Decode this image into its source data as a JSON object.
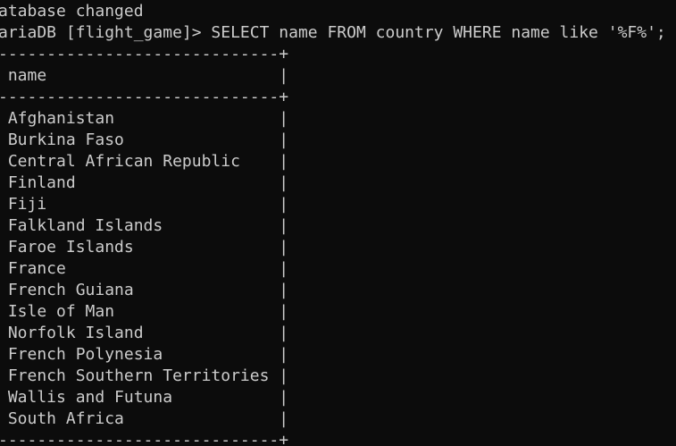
{
  "terminal": {
    "status_line": "atabase changed",
    "prompt": "ariaDB [flight_game]> ",
    "command": "SELECT name FROM country WHERE name like '%F%';",
    "border_top": "-----------------------------+",
    "header_row": " name                        |",
    "border_mid": "-----------------------------+",
    "rows": [
      " Afghanistan                 |",
      " Burkina Faso                |",
      " Central African Republic    |",
      " Finland                     |",
      " Fiji                        |",
      " Falkland Islands            |",
      " Faroe Islands               |",
      " France                      |",
      " French Guiana               |",
      " Isle of Man                 |",
      " Norfolk Island              |",
      " French Polynesia            |",
      " French Southern Territories |",
      " Wallis and Futuna           |",
      " South Africa                |"
    ],
    "border_bottom": "-----------------------------+"
  }
}
